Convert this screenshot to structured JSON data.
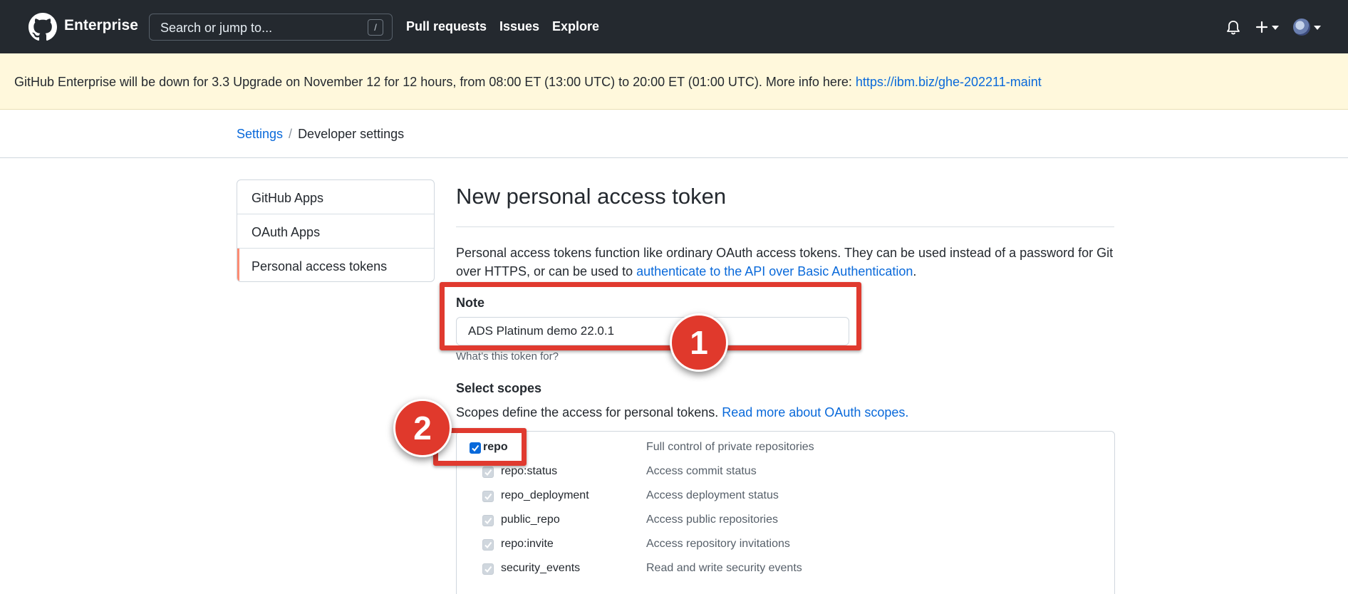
{
  "header": {
    "brand": "Enterprise",
    "search_placeholder": "Search or jump to...",
    "search_shortcut": "/",
    "nav": [
      "Pull requests",
      "Issues",
      "Explore"
    ],
    "icons": [
      "github-logo-icon",
      "bell-icon",
      "plus-icon",
      "chevron-down-icon",
      "avatar"
    ]
  },
  "banner": {
    "text": "GitHub Enterprise will be down for 3.3 Upgrade on November 12 for 12 hours, from 08:00 ET (13:00 UTC) to 20:00 ET (01:00 UTC). More info here: ",
    "link": "https://ibm.biz/ghe-202211-maint"
  },
  "breadcrumb": {
    "root": "Settings",
    "separator": "/",
    "current": "Developer settings"
  },
  "sidebar": {
    "items": [
      {
        "label": "GitHub Apps"
      },
      {
        "label": "OAuth Apps"
      },
      {
        "label": "Personal access tokens",
        "active": true
      }
    ]
  },
  "main": {
    "title": "New personal access token",
    "description_1": "Personal access tokens function like ordinary OAuth access tokens. They can be used instead of a password for Git over HTTPS, or can be used to ",
    "description_link": "authenticate to the API over Basic Authentication",
    "description_2": ".",
    "note_label": "Note",
    "note_value": "ADS Platinum demo 22.0.1",
    "note_hint": "What’s this token for?",
    "scopes_heading": "Select scopes",
    "scopes_desc": "Scopes define the access for personal tokens. ",
    "scopes_link": "Read more about OAuth scopes.",
    "scopes": [
      {
        "name": "repo",
        "desc": "Full control of private repositories",
        "checked": true
      },
      {
        "name": "repo:status",
        "desc": "Access commit status",
        "checked": true
      },
      {
        "name": "repo_deployment",
        "desc": "Access deployment status",
        "checked": true
      },
      {
        "name": "public_repo",
        "desc": "Access public repositories",
        "checked": true
      },
      {
        "name": "repo:invite",
        "desc": "Access repository invitations",
        "checked": true
      },
      {
        "name": "security_events",
        "desc": "Read and write security events",
        "checked": true
      }
    ]
  },
  "annotations": {
    "step1": "1",
    "step2": "2",
    "color": "#e0392c"
  },
  "colors": {
    "header_bg": "#24292f",
    "banner_bg": "#fff8dc",
    "link": "#0969da",
    "active_marker": "#fd8c73"
  }
}
